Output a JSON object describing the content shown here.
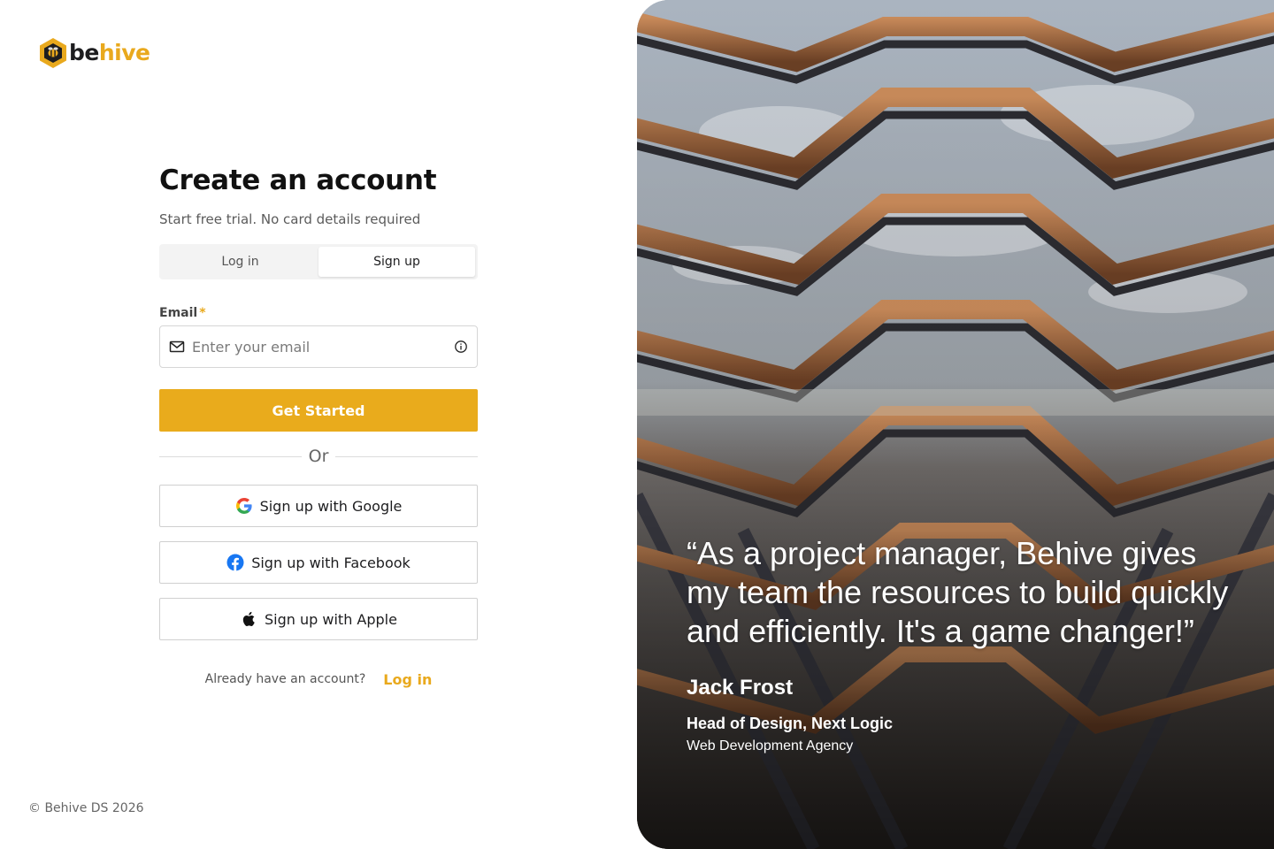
{
  "brand": {
    "name_part1": "be",
    "name_part2": "hive",
    "accent": "#E9AB1C",
    "logo_icon": "bee-hexagon-icon"
  },
  "form": {
    "title": "Create an account",
    "subtitle": "Start free trial. No card details required",
    "tabs": [
      {
        "label": "Log in",
        "active": false
      },
      {
        "label": "Sign up",
        "active": true
      }
    ],
    "email": {
      "label": "Email",
      "required_marker": "*",
      "placeholder": "Enter your email",
      "value": "",
      "leading_icon": "mail-icon",
      "trailing_icon": "info-icon"
    },
    "primary_button": "Get Started",
    "divider": "Or",
    "social": [
      {
        "label": "Sign up with Google",
        "icon": "google-icon"
      },
      {
        "label": "Sign up with Facebook",
        "icon": "facebook-icon"
      },
      {
        "label": "Sign up with Apple",
        "icon": "apple-icon"
      }
    ],
    "already_text": "Already have an account?",
    "login_link": "Log in"
  },
  "footer": {
    "copyright": "© Behive DS 2026"
  },
  "testimonial": {
    "quote": "“As a project manager, Behive gives my team the resources to build quickly and efficiently. It's a game changer!”",
    "author": "Jack Frost",
    "role": "Head of Design, Next Logic",
    "company": "Web Development Agency",
    "background": "architecture-photo"
  }
}
